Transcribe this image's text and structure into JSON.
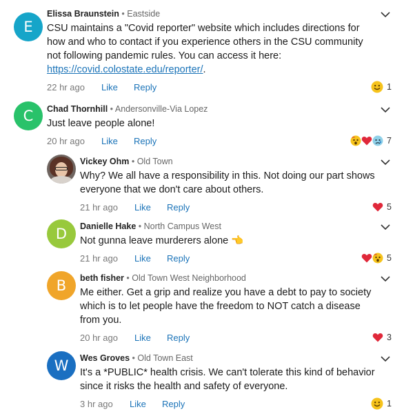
{
  "comments": [
    {
      "initial": "E",
      "avatar_color": "#16a5c9",
      "author": "Elissa Braunstein",
      "separator": "•",
      "location": "Eastside",
      "text": "CSU maintains a \"Covid reporter\" website which includes directions for how and who to contact if you experience others in the CSU community not following pandemic rules. You can access it here:",
      "link": "https://covid.colostate.edu/reporter/",
      "link_suffix": ".",
      "time": "22 hr ago",
      "like": "Like",
      "reply": "Reply",
      "reactions": [
        "smile-emoji"
      ],
      "reaction_count": "1"
    },
    {
      "initial": "C",
      "avatar_color": "#29c26a",
      "author": "Chad Thornhill",
      "separator": "•",
      "location": "Andersonville-Via Lopez",
      "text": "Just leave people alone!",
      "time": "20 hr ago",
      "like": "Like",
      "reply": "Reply",
      "reactions": [
        "wow-emoji",
        "heart-emoji",
        "sad-emoji"
      ],
      "reaction_count": "7"
    },
    {
      "avatar_type": "photo",
      "author": "Vickey Ohm",
      "separator": "•",
      "location": "Old Town",
      "text": "Why? We all have a responsibility in this. Not doing our part shows everyone that we don't care about others.",
      "time": "21 hr ago",
      "like": "Like",
      "reply": "Reply",
      "reactions": [
        "heart-emoji"
      ],
      "reaction_count": "5"
    },
    {
      "initial": "D",
      "avatar_color": "#98c93c",
      "author": "Danielle Hake",
      "separator": "•",
      "location": "North Campus West",
      "text": "Not gunna leave murderers alone 👈",
      "time": "21 hr ago",
      "like": "Like",
      "reply": "Reply",
      "reactions": [
        "heart-emoji",
        "wow-emoji"
      ],
      "reaction_count": "5"
    },
    {
      "initial": "B",
      "avatar_color": "#f0a52a",
      "author": "beth fisher",
      "separator": "•",
      "location": "Old Town West Neighborhood",
      "text": "Me either. Get a  grip and realize you have a debt to pay to society which is to let people have the freedom to  NOT catch a disease from you.",
      "time": "20 hr ago",
      "like": "Like",
      "reply": "Reply",
      "reactions": [
        "heart-emoji"
      ],
      "reaction_count": "3"
    },
    {
      "initial": "W",
      "avatar_color": "#1a6fc1",
      "author": "Wes Groves",
      "separator": "•",
      "location": "Old Town East",
      "text": "It's a *PUBLIC* health crisis. We can't tolerate this kind of behavior since it risks the health and safety of everyone.",
      "time": "3 hr ago",
      "like": "Like",
      "reply": "Reply",
      "reactions": [
        "smile-emoji"
      ],
      "reaction_count": "1"
    }
  ]
}
